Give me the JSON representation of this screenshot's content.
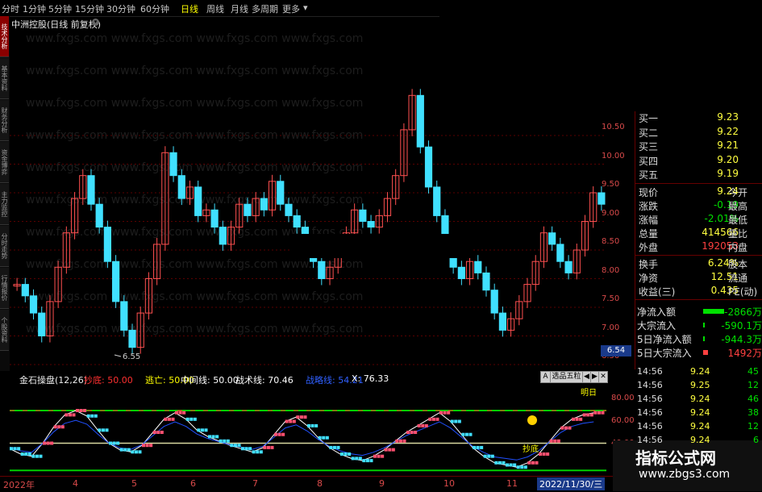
{
  "toolbar": {
    "periods": [
      "分时",
      "1分钟",
      "5分钟",
      "15分钟",
      "30分钟",
      "60分钟",
      "日线",
      "周线",
      "月线",
      "多周期",
      "更多"
    ],
    "active": "日线"
  },
  "left_tabs": [
    "技术分析",
    "基本资料",
    "财务分析",
    "资金博弈",
    "主力监控",
    "分时走势",
    "行情报价",
    "个股资料"
  ],
  "stock": {
    "title": "中洲控股(日线 前复权)"
  },
  "main_chart": {
    "price_ticks": [
      "10.50",
      "10.00",
      "9.50",
      "9.00",
      "8.50",
      "8.00",
      "7.50",
      "7.00",
      "6.50"
    ],
    "low_label": "6.55",
    "current_price_tag": "6.54"
  },
  "quote": {
    "bids": [
      {
        "label": "买一",
        "value": "9.23"
      },
      {
        "label": "买二",
        "value": "9.22"
      },
      {
        "label": "买三",
        "value": "9.21"
      },
      {
        "label": "买四",
        "value": "9.20"
      },
      {
        "label": "买五",
        "value": "9.19"
      }
    ],
    "stats": [
      {
        "label": "现价",
        "value": "9.24",
        "label2": "今开",
        "color": "yellow"
      },
      {
        "label": "涨跌",
        "value": "-0.19",
        "label2": "最高",
        "color": "green"
      },
      {
        "label": "涨幅",
        "value": "-2.01%",
        "label2": "最低",
        "color": "green"
      },
      {
        "label": "总量",
        "value": "414566",
        "label2": "量比",
        "color": "yellow"
      },
      {
        "label": "外盘",
        "value": "192053",
        "label2": "内盘",
        "color": "red"
      }
    ],
    "stats2": [
      {
        "label": "换手",
        "value": "6.24%",
        "label2": "股本"
      },
      {
        "label": "净资",
        "value": "12.51",
        "label2": "流通"
      },
      {
        "label": "收益(三)",
        "value": "0.435",
        "label2": "PE(动)"
      }
    ]
  },
  "flows": [
    {
      "label": "净流入额",
      "value": "-2866万",
      "color": "#00e000",
      "bar": 0.85
    },
    {
      "label": "大宗流入",
      "value": "-590.1万",
      "color": "#00e000",
      "bar": 0.08
    },
    {
      "label": "5日净流入额",
      "value": "-944.3万",
      "color": "#00e000",
      "bar": 0.05
    },
    {
      "label": "5日大宗流入",
      "value": "1492万",
      "color": "#ff4040",
      "bar": 0.2
    }
  ],
  "ticks": [
    {
      "time": "14:56",
      "price": "9.24",
      "vol": "45"
    },
    {
      "time": "14:56",
      "price": "9.25",
      "vol": "12"
    },
    {
      "time": "14:56",
      "price": "9.24",
      "vol": "46"
    },
    {
      "time": "14:56",
      "price": "9.24",
      "vol": "38"
    },
    {
      "time": "14:56",
      "price": "9.24",
      "vol": "12"
    },
    {
      "time": "14:56",
      "price": "9.24",
      "vol": "6"
    }
  ],
  "indicator": {
    "name": "金石操盘(12,26)",
    "items": [
      {
        "text": "抄底: 50.00",
        "color": "#ff3030"
      },
      {
        "text": "逃亡: 50.00",
        "color": "#ffff00"
      },
      {
        "text": "中间线: 50.00",
        "color": "#ffffff"
      },
      {
        "text": "战术线: 70.46",
        "color": "#ffffff"
      },
      {
        "text": "战略线: 54.21",
        "color": "#3060ff"
      },
      {
        "text": "X: 76.33",
        "color": "#ffffff"
      }
    ],
    "ticks": [
      "80.00",
      "60.00",
      "40.00"
    ],
    "controls": [
      "A",
      "选品五粒",
      "◀",
      "▶",
      "✕"
    ],
    "labels": {
      "sell": "明日",
      "buy": "抄底"
    }
  },
  "date_axis": {
    "labels": [
      "2022年",
      "4",
      "5",
      "6",
      "7",
      "8",
      "9",
      "10",
      "11"
    ],
    "current_date": "2022/11/30/三"
  },
  "watermark": {
    "main": "指标公式网",
    "sub": "www.zbgs3.com"
  }
}
